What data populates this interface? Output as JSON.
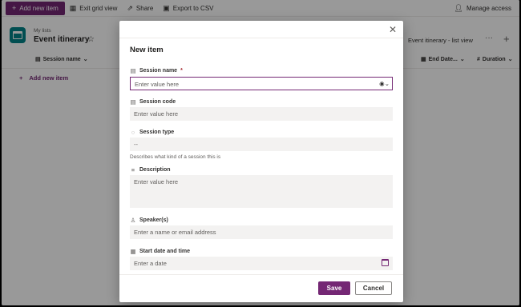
{
  "command_bar": {
    "add_new_item": "Add new item",
    "exit_grid_view": "Exit grid view",
    "share": "Share",
    "export_csv": "Export to CSV",
    "manage_access": "Manage access"
  },
  "list": {
    "breadcrumb": "My lists",
    "title": "Event itinerary",
    "view_name": "Event itinerary - list view"
  },
  "grid": {
    "columns": [
      "Session name",
      "End Date...",
      "Duration"
    ],
    "add_row": "Add new item"
  },
  "dialog": {
    "title": "New item",
    "fields": {
      "session_name": {
        "label": "Session name",
        "required_marker": "*",
        "placeholder": "Enter value here"
      },
      "session_code": {
        "label": "Session code",
        "placeholder": "Enter value here"
      },
      "session_type": {
        "label": "Session type",
        "value": "--",
        "helper": "Describes what kind of a session this is"
      },
      "description": {
        "label": "Description",
        "placeholder": "Enter value here"
      },
      "speakers": {
        "label": "Speaker(s)",
        "placeholder": "Enter a name or email address"
      },
      "start_date": {
        "label": "Start date and time",
        "placeholder": "Enter a date"
      }
    },
    "save": "Save",
    "cancel": "Cancel"
  },
  "colors": {
    "accent": "#742774",
    "list_icon": "#038387"
  }
}
